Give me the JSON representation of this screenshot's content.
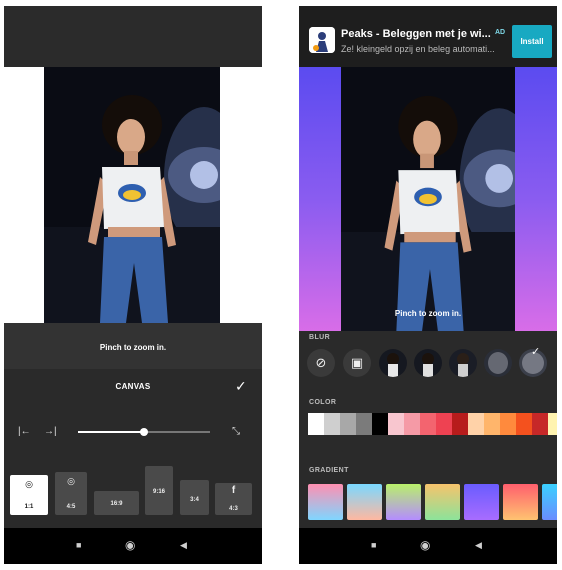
{
  "left": {
    "hint": "Pinch to zoom in.",
    "canvas_title": "CANVAS",
    "check_icon": "check-icon",
    "slider_value": 0.5,
    "ratios": [
      {
        "label": "1:1",
        "icon": "instagram-icon",
        "selected": true
      },
      {
        "label": "4:5",
        "icon": "instagram-icon",
        "selected": false
      },
      {
        "label": "16:9",
        "icon": "",
        "selected": false
      },
      {
        "label": "9:16",
        "icon": "",
        "selected": false
      },
      {
        "label": "3:4",
        "icon": "",
        "selected": false
      },
      {
        "label": "4:3",
        "icon": "facebook-icon",
        "selected": false
      }
    ]
  },
  "right": {
    "ad": {
      "title": "Peaks - Beleggen met je wi...",
      "badge": "AD",
      "description": "Ze! kleingeld opzij en beleg automati...",
      "install": "Install"
    },
    "hint": "Pinch to zoom in.",
    "sections": {
      "blur": "BLUR",
      "color": "COLOR",
      "gradient": "GRADIENT"
    },
    "colors": [
      "#ffffff",
      "#cfcfcf",
      "#a8a8a8",
      "#7b7b7b",
      "#000000",
      "#f8c6cf",
      "#f59aa6",
      "#f3646f",
      "#ee4252",
      "#b71c1c",
      "#ffd2a8",
      "#ffb56b",
      "#ff8a3d",
      "#f4511e",
      "#c62828",
      "#fff3b0"
    ],
    "gradients": [
      [
        "#ff8fb1",
        "#7fd6ff"
      ],
      [
        "#7ad8ff",
        "#ffb8a0"
      ],
      [
        "#b9f06a",
        "#b48cff"
      ],
      [
        "#f6c36c",
        "#8ce39a"
      ],
      [
        "#6a5cff",
        "#a86cff"
      ],
      [
        "#ff5f6d",
        "#ffc371"
      ],
      [
        "#3ad1ff",
        "#6a8bff"
      ]
    ]
  },
  "nav": {
    "back": "◀",
    "home": "◉",
    "recents": "■"
  }
}
